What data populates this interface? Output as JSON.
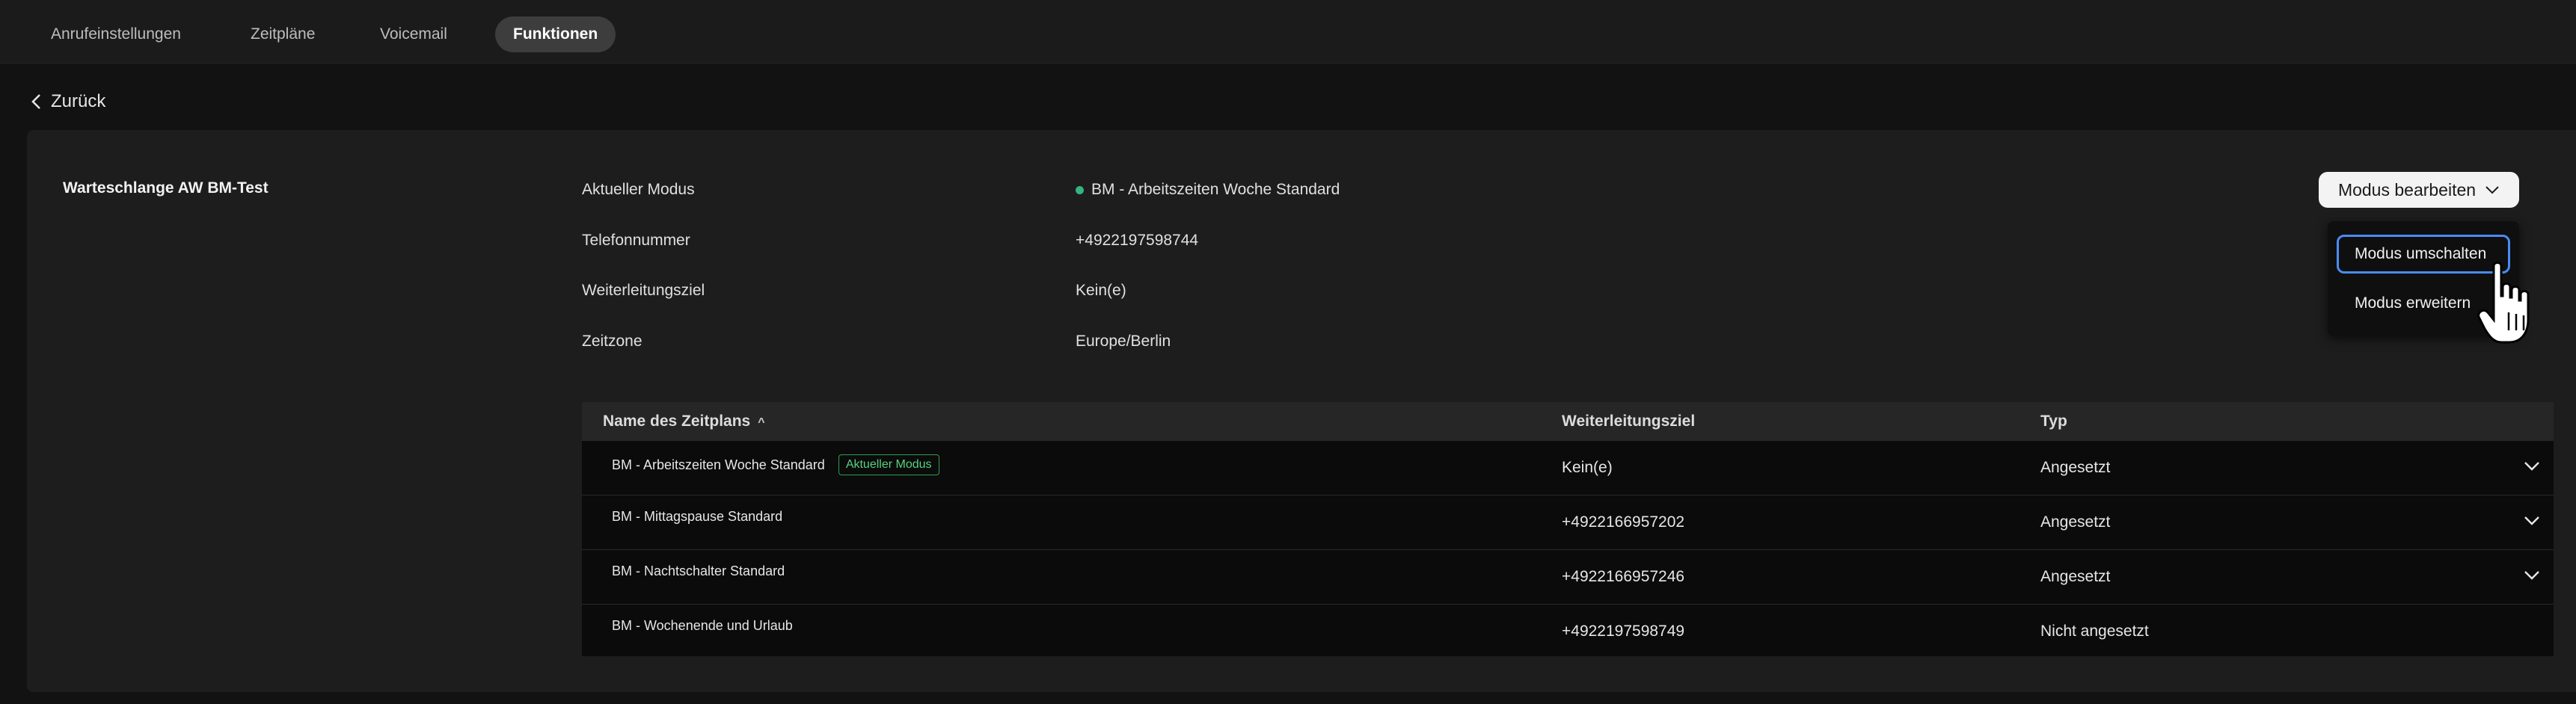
{
  "tabs": [
    {
      "label": "Anrufeinstellungen",
      "active": false
    },
    {
      "label": "Zeitpläne",
      "active": false
    },
    {
      "label": "Voicemail",
      "active": false
    },
    {
      "label": "Funktionen",
      "active": true
    }
  ],
  "back": {
    "label": "Zurück"
  },
  "queue": {
    "title": "Warteschlange AW BM-Test"
  },
  "info": {
    "mode_label": "Aktueller Modus",
    "mode_value": "BM - Arbeitszeiten Woche Standard",
    "mode_status_color": "#36b37e",
    "phone_label": "Telefonnummer",
    "phone_value": "+4922197598744",
    "forward_label": "Weiterleitungsziel",
    "forward_value": "Kein(e)",
    "tz_label": "Zeitzone",
    "tz_value": "Europe/Berlin"
  },
  "edit_button": {
    "label": "Modus bearbeiten"
  },
  "menu": {
    "items": [
      "Modus umschalten",
      "Modus erweitern"
    ]
  },
  "table": {
    "headers": [
      "Name des Zeitplans",
      "Weiterleitungsziel",
      "Typ"
    ],
    "rows": [
      {
        "name": "BM - Arbeitszeiten Woche Standard",
        "badge": "Aktueller Modus",
        "target": "Kein(e)",
        "type": "Angesetzt"
      },
      {
        "name": "BM - Mittagspause Standard",
        "badge": "",
        "target": "+4922166957202",
        "type": "Angesetzt"
      },
      {
        "name": "BM - Nachtschalter Standard",
        "badge": "",
        "target": "+4922166957246",
        "type": "Angesetzt"
      },
      {
        "name": "BM - Wochenende und Urlaub",
        "badge": "",
        "target": "+4922197598749",
        "type": "Nicht angesetzt"
      }
    ]
  },
  "colors": {
    "accent_focus": "#4a8bf5",
    "badge_green": "#57d17f"
  }
}
